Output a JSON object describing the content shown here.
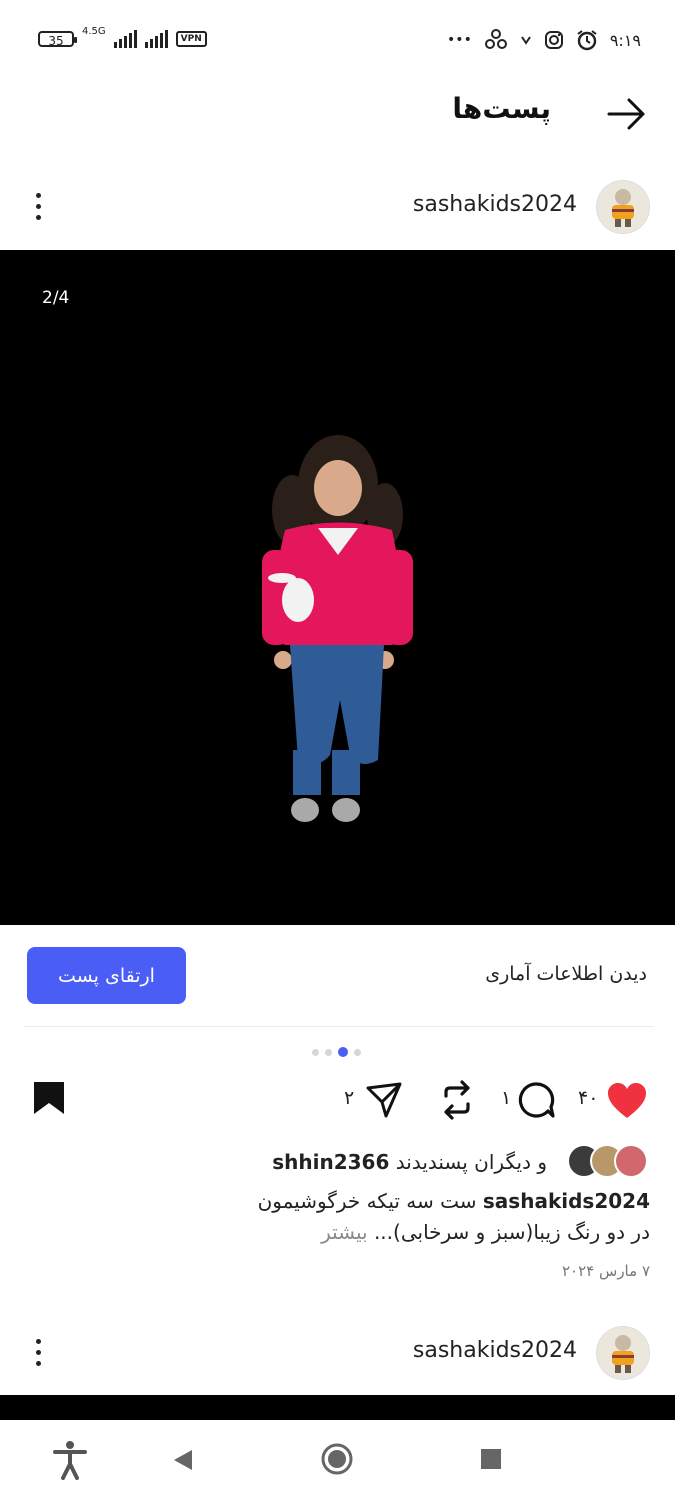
{
  "status_bar": {
    "battery": "35",
    "network": "4.5G",
    "vpn": "VPN",
    "dots": "•••",
    "time": "۹:۱۹"
  },
  "header": {
    "title": "پست‌ها"
  },
  "post": {
    "username": "sashakids2024",
    "image_counter": "2/4",
    "stats_link": "دیدن اطلاعات آماری",
    "promote_button": "ارتقای پست",
    "likes_count": "۴۰",
    "comments_count": "۱",
    "shares_count": "۲",
    "liked_by_user": "shhin2366",
    "liked_by_suffix": "و دیگران پسندیدند",
    "caption_user": "sashakids2024",
    "caption_line1": "ست سه تیکه خرگوشیمون",
    "caption_line2": "در دو رنگ زیبا(سبز  و سرخابی)...",
    "caption_more": "بیشتر",
    "date": "۷ مارس ۲۰۲۴",
    "carousel_active": 3,
    "carousel_total": 4
  },
  "next_post": {
    "username": "sashakids2024"
  },
  "colors": {
    "accent": "#4a5ef5",
    "like": "#f0313f"
  }
}
